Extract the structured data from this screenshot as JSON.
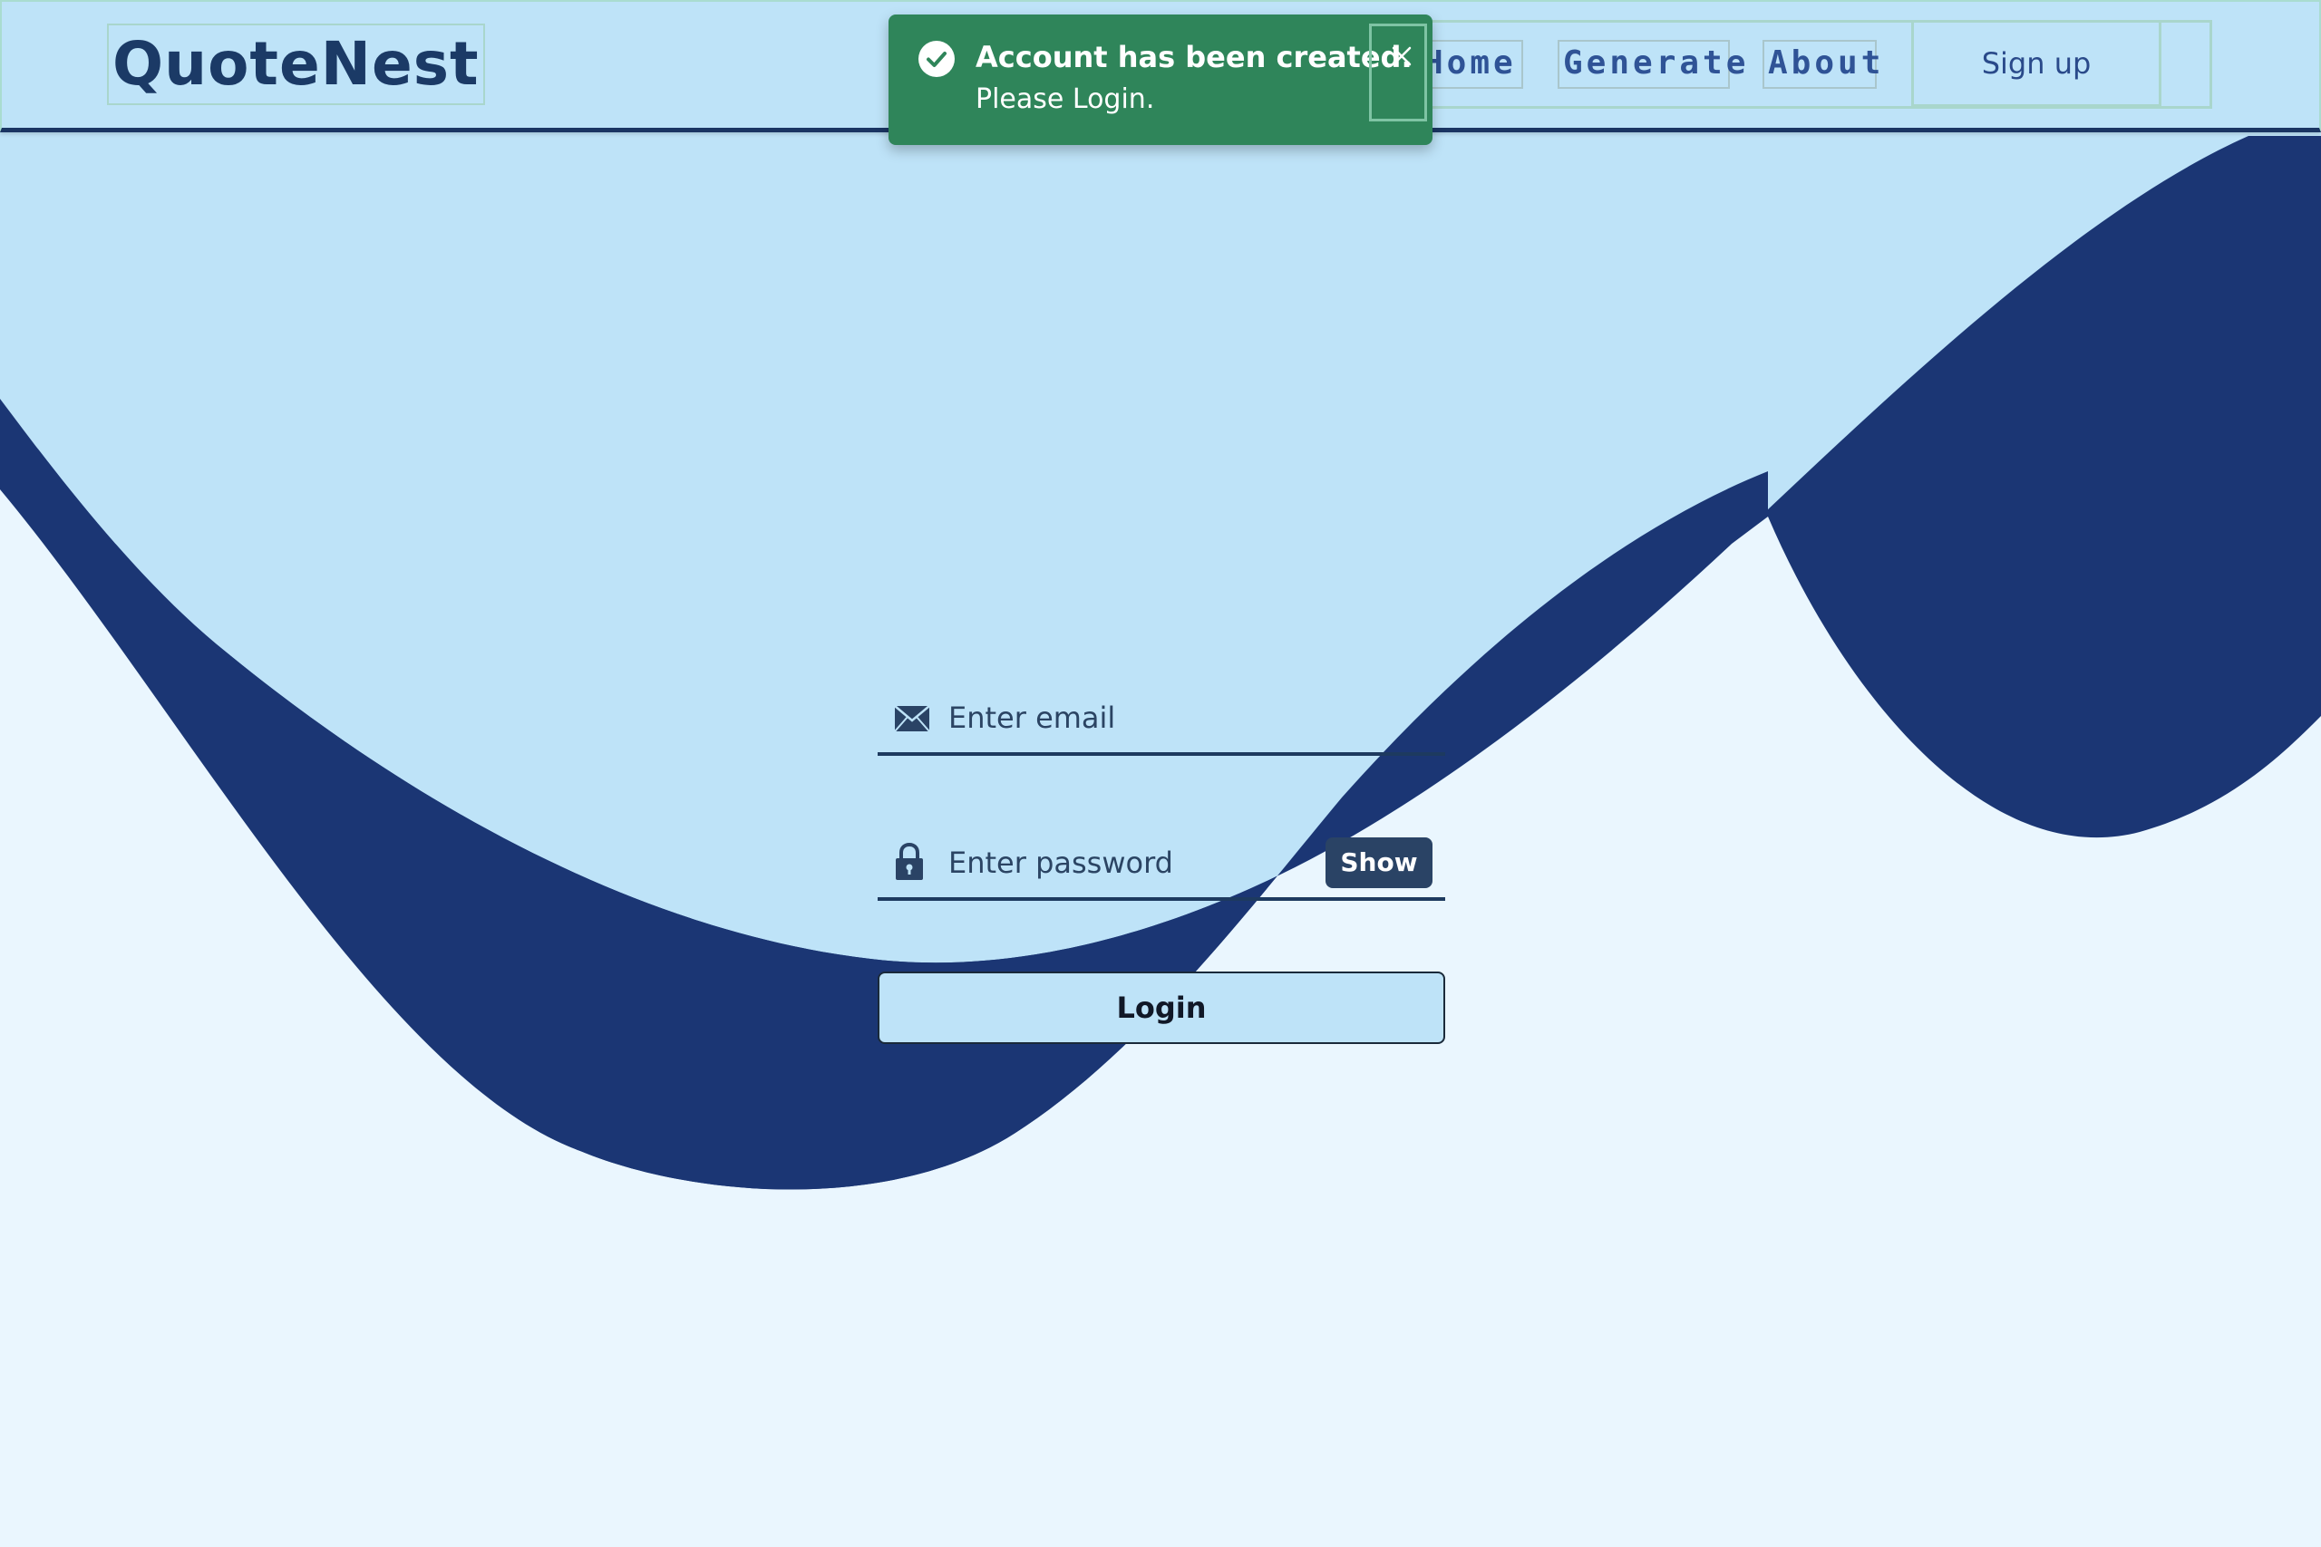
{
  "app": {
    "brand": "QuoteNest"
  },
  "nav": {
    "links": [
      {
        "label": "Home"
      },
      {
        "label": "Generate"
      },
      {
        "label": "About"
      }
    ],
    "signup_label": "Sign up"
  },
  "toast": {
    "title": "Account has been created.",
    "description": "Please Login.",
    "status": "success",
    "icon": "check-circle-icon",
    "close_icon": "close-icon"
  },
  "form": {
    "email": {
      "placeholder": "Enter email",
      "value": "",
      "icon": "envelope-icon"
    },
    "password": {
      "placeholder": "Enter password",
      "value": "",
      "icon": "lock-icon",
      "toggle_label": "Show"
    },
    "submit_label": "Login"
  },
  "colors": {
    "background": "#eaf6fe",
    "light_blue": "#bee3f8",
    "navy": "#1b3674",
    "toast_green": "#2f855a",
    "show_button": "#2a4365"
  }
}
